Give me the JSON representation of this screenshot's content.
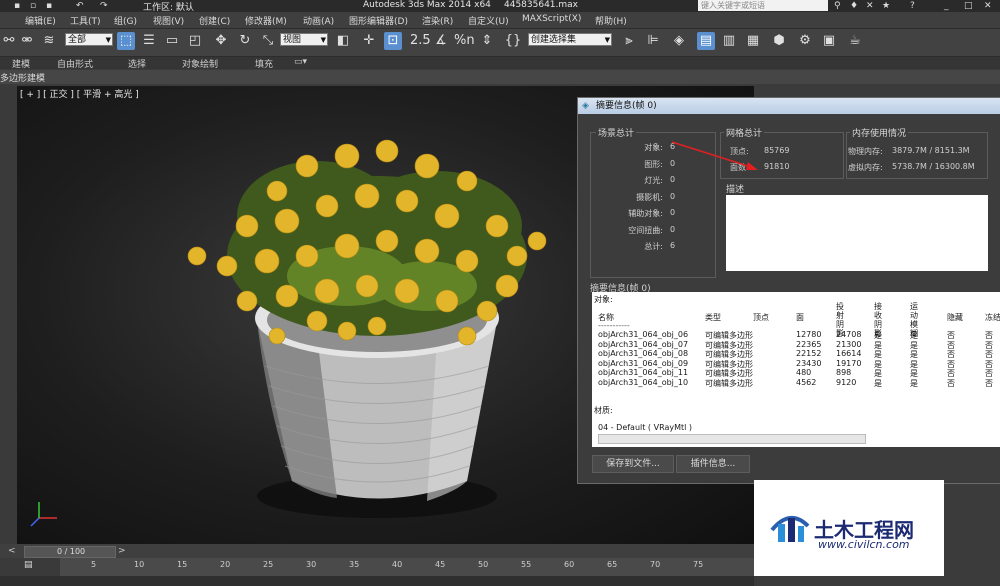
{
  "titlebar": {
    "workspace_label": "工作区: 默认",
    "app_title": "Autodesk 3ds Max  2014 x64",
    "file_name": "445835641.max",
    "search_placeholder": "键入关键字或短语"
  },
  "menu": [
    "编辑(E)",
    "工具(T)",
    "组(G)",
    "视图(V)",
    "创建(C)",
    "修改器(M)",
    "动画(A)",
    "图形编辑器(D)",
    "渲染(R)",
    "自定义(U)",
    "MAXScript(X)",
    "帮助(H)"
  ],
  "toolbar": {
    "filter_value": "全部",
    "coord_value": "视图",
    "selection_set_value": "创建选择集",
    "snap_percent": "%n",
    "snap_num": "2.5"
  },
  "ribbon": {
    "tabs": [
      "建模",
      "自由形式",
      "选择",
      "对象绘制",
      "填充"
    ],
    "panel_label": "多边形建模"
  },
  "viewport": {
    "label": "[ + ] [ 正交 ] [ 平滑 + 高光 ]"
  },
  "dialog": {
    "title": "摘要信息(帧 0)",
    "scene_totals": {
      "title": "场景总计",
      "rows": [
        {
          "label": "对象:",
          "value": "6"
        },
        {
          "label": "图形:",
          "value": "0"
        },
        {
          "label": "灯光:",
          "value": "0"
        },
        {
          "label": "摄影机:",
          "value": "0"
        },
        {
          "label": "辅助对象:",
          "value": "0"
        },
        {
          "label": "空间扭曲:",
          "value": "0"
        },
        {
          "label": "总计:",
          "value": "6"
        }
      ]
    },
    "mesh_totals": {
      "title": "网格总计",
      "rows": [
        {
          "label": "顶点:",
          "value": "85769"
        },
        {
          "label": "面数:",
          "value": "91810"
        }
      ]
    },
    "memory": {
      "title": "内存使用情况",
      "rows": [
        {
          "label": "物理内存:",
          "value": "3879.7M / 8151.3M"
        },
        {
          "label": "虚拟内存:",
          "value": "5738.7M / 16300.8M"
        }
      ]
    },
    "description_title": "描述",
    "summary_title": "摘要信息(帧 0)",
    "objects_label": "对象:",
    "columns": [
      "名称",
      "类型",
      "顶点",
      "面",
      "投射阴影",
      "接收阴影",
      "运动模糊",
      "隐藏",
      "冻结"
    ],
    "rows": [
      {
        "name": "objArch31_064_obj_06",
        "type": "可编辑多边形",
        "verts": "12780",
        "faces": "24708"
      },
      {
        "name": "objArch31_064_obj_07",
        "type": "可编辑多边形",
        "verts": "22365",
        "faces": "21300"
      },
      {
        "name": "objArch31_064_obj_08",
        "type": "可编辑多边形",
        "verts": "22152",
        "faces": "16614"
      },
      {
        "name": "objArch31_064_obj_09",
        "type": "可编辑多边形",
        "verts": "23430",
        "faces": "19170"
      },
      {
        "name": "objArch31_064_obj_11",
        "type": "可编辑多边形",
        "verts": "480",
        "faces": "898"
      },
      {
        "name": "objArch31_064_obj_10",
        "type": "可编辑多边形",
        "verts": "4562",
        "faces": "9120"
      }
    ],
    "flag_yes": "是",
    "flag_no": "否",
    "materials_label": "材质:",
    "material_entry": "04 - Default ( VRayMtl )",
    "save_button": "保存到文件...",
    "plugin_button": "插件信息..."
  },
  "timeline": {
    "frame_counter": "0 / 100",
    "ticks": [
      "5",
      "10",
      "15",
      "20",
      "25",
      "30",
      "35",
      "40",
      "45",
      "50",
      "55",
      "60",
      "65",
      "70",
      "75"
    ]
  },
  "watermark": {
    "brand": "土木工程网",
    "url": "www.civilcn.com"
  }
}
